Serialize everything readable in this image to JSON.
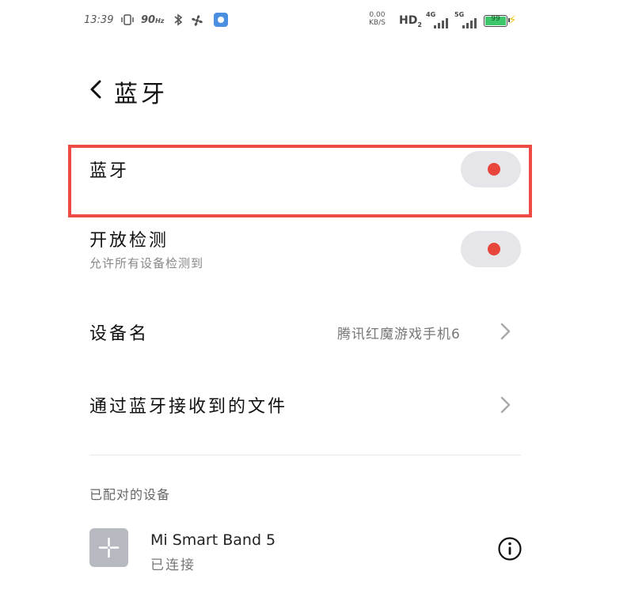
{
  "status_bar": {
    "time": "13:39",
    "refresh_rate": "90",
    "refresh_unit": "Hz",
    "net_speed_value": "0.00",
    "net_speed_unit": "KB/S",
    "hd_label": "HD",
    "hd_sub": "2",
    "network_1": "4G",
    "network_2": "5G",
    "battery_level": "99",
    "battery_fraction": 0.99
  },
  "header": {
    "title": "蓝牙"
  },
  "bluetooth": {
    "label": "蓝牙",
    "enabled": true
  },
  "discoverable": {
    "label": "开放检测",
    "description": "允许所有设备检测到",
    "enabled": true
  },
  "device_name": {
    "label": "设备名",
    "value": "腾讯红魔游戏手机6"
  },
  "received_files": {
    "label": "通过蓝牙接收到的文件"
  },
  "paired_section": {
    "title": "已配对的设备",
    "devices": [
      {
        "name": "Mi Smart Band 5",
        "status": "已连接"
      }
    ]
  },
  "colors": {
    "accent": "#e8453c",
    "highlight_border": "#f04a44",
    "toggle_track": "#e6e6ea"
  }
}
